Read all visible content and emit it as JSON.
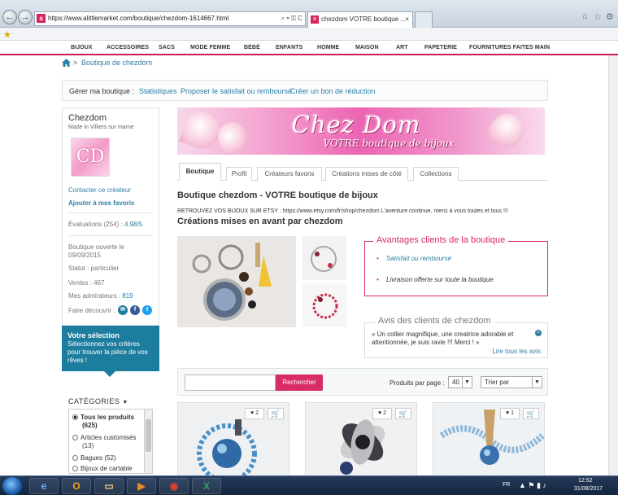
{
  "browser": {
    "url": "https://www.alittlemarket.com/boutique/chezdom-1614667.html",
    "tab_title": "chezdom VOTRE boutique ...",
    "back_label": "←",
    "forward_label": "→",
    "addr_controls": "⌕ ▾ ⚿ C"
  },
  "site_nav": [
    "BIJOUX",
    "ACCESSOIRES",
    "SACS",
    "MODE FEMME",
    "BÉBÉ",
    "ENFANTS",
    "HOMME",
    "MAISON",
    "ART",
    "PAPETERIE",
    "FOURNITURES FAITES MAIN"
  ],
  "breadcrumb": {
    "separator": ">",
    "current": "Boutique de chezdom"
  },
  "manage": {
    "label": "Gérer ma boutique :",
    "links": [
      "Statistiques",
      "Proposer le satisfait ou remboursé",
      "Créer un bon de réduction"
    ]
  },
  "seller": {
    "name": "Chezdom",
    "location": "Made in Villiers sur marne",
    "logo_text": "CD",
    "contact": "Contacter ce créateur",
    "favorite": "Ajouter à mes favoris",
    "ratings_label": "Évaluations (254) :",
    "ratings_value": "4.98/5",
    "opened_label": "Boutique ouverte le",
    "opened_date": "09/09/2015",
    "status": "Statut : particulier",
    "sales": "Ventes : 467",
    "admirers_label": "Mes admirateurs :",
    "admirers_value": "819",
    "discover": "Faire découvrir :"
  },
  "selection": {
    "title": "Votre sélection",
    "desc": "Sélectionnez vos critères pour trouver la pièce de vos rêves !"
  },
  "categories": {
    "title": "CATÉGORIES",
    "items": [
      {
        "label": "Tous les produits",
        "count": "(625)"
      },
      {
        "label": "Articles customisés",
        "count": "(13)"
      },
      {
        "label": "Bagues",
        "count": "(52)"
      },
      {
        "label": "Bijoux de cartable",
        "count": ""
      }
    ]
  },
  "banner": {
    "title": "Chez Dom",
    "subtitle": "VOTRE boutique de bijoux"
  },
  "tabs": [
    "Boutique",
    "Profil",
    "Créateurs favoris",
    "Créations mises de côté",
    "Collections"
  ],
  "shop": {
    "heading": "Boutique chezdom - VOTRE boutique de bijoux",
    "description": "RETROUVEZ VOS BIJOUX SUR ETSY : https://www.etsy.com/fr/shop/chezdom L'aventure continue, merci à vous toutes et tous !!!",
    "featured_heading": "Créations mises en avant par chezdom"
  },
  "advantages": {
    "title": "Avantages clients de la boutique",
    "items": [
      "Satisfait ou remboursé",
      "Livraison offerte sur toute la boutique"
    ]
  },
  "reviews": {
    "title": "Avis des clients de chezdom",
    "quote": "« Un collier magnifique, une creatrice adorable et attentionnée, je suis ravie !!! Merci ! »",
    "all_link": "Lire tous les avis"
  },
  "search": {
    "button": "Rechercher",
    "per_page_label": "Produits par page :",
    "per_page_value": "40",
    "sort_value": "Trier par"
  },
  "products": [
    {
      "likes": "2"
    },
    {
      "likes": "2"
    },
    {
      "likes": "1"
    }
  ],
  "taskbar": {
    "lang": "FR",
    "time": "12:52",
    "date": "31/08/2017"
  },
  "colors": {
    "brand": "#d82c64",
    "link": "#2e7fa6",
    "selection_bg": "#1d7d9e"
  }
}
